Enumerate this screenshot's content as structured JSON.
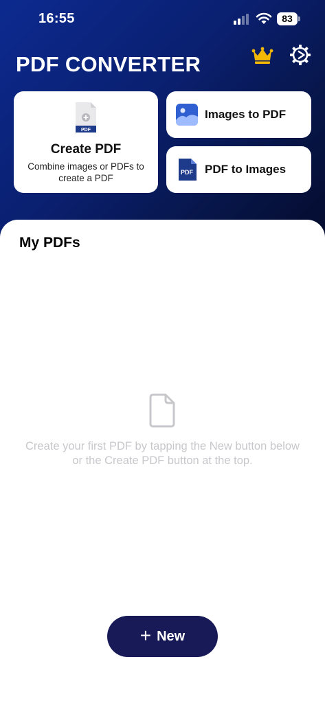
{
  "status_bar": {
    "time": "16:55",
    "battery": "83",
    "icons": [
      "signal-icon",
      "wifi-icon",
      "battery-icon"
    ]
  },
  "header": {
    "title": "PDF CONVERTER",
    "icons": [
      "crown-icon",
      "settings-icon"
    ],
    "gradient_colors": [
      "#0c2a8f",
      "#040b2c"
    ]
  },
  "cards": {
    "create_pdf": {
      "title": "Create PDF",
      "description": "Combine images or PDFs to create a PDF",
      "icon": "pdf-document-icon",
      "icon_tag": "PDF"
    },
    "images_to_pdf": {
      "label": "Images to PDF",
      "icon": "image-icon"
    },
    "pdf_to_images": {
      "label": "PDF to Images",
      "icon": "pdf-file-icon",
      "icon_tag": "PDF"
    }
  },
  "my_pdfs": {
    "title": "My PDFs",
    "empty_icon": "blank-document-icon",
    "empty_text": "Create your first PDF by tapping the New button below or the Create PDF button at the top."
  },
  "new_button": {
    "icon": "plus-icon",
    "label": "New",
    "color": "#171a57"
  },
  "colors": {
    "accent_gold": "#f2b705",
    "navy": "#171a57",
    "empty_text": "#c8c8cc"
  }
}
